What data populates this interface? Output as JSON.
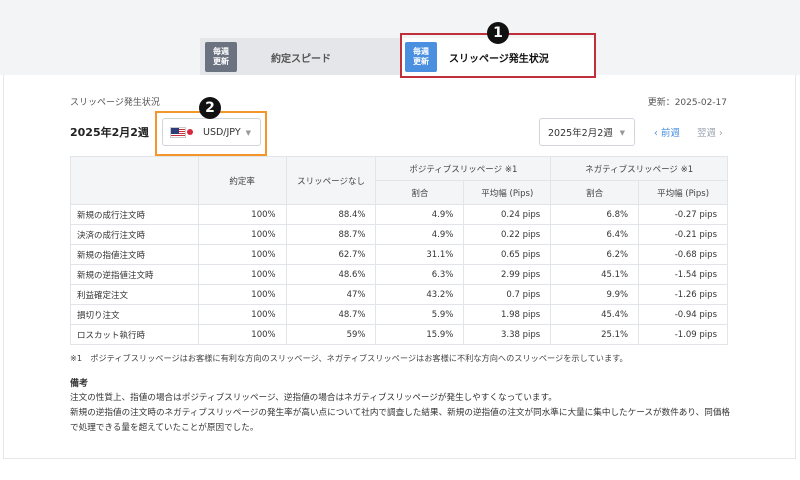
{
  "tabs": [
    {
      "badge_line1": "毎週",
      "badge_line2": "更新",
      "label": "約定スピード"
    },
    {
      "badge_line1": "毎週",
      "badge_line2": "更新",
      "label": "スリッページ発生状況"
    }
  ],
  "callouts": [
    "1",
    "2"
  ],
  "section_title": "スリッページ発生状況",
  "updated": "更新：2025-02-17",
  "week_label": "2025年2月2週",
  "currency": {
    "flag": "us-flag-icon",
    "value": "USD/JPY"
  },
  "date_select": "2025年2月2週",
  "nav": {
    "prev": "‹ 前週",
    "next": "翌週 ›"
  },
  "table": {
    "headers": {
      "fill_rate": "約定率",
      "no_slip": "スリッページなし",
      "positive": "ポジティブスリッページ ※1",
      "negative": "ネガティブスリッページ ※1",
      "ratio": "割合",
      "avg": "平均幅 (Pips)"
    },
    "rows": [
      {
        "label": "新規の成行注文時",
        "fill": "100%",
        "none": "88.4%",
        "pos_ratio": "4.9%",
        "pos_avg": "0.24 pips",
        "neg_ratio": "6.8%",
        "neg_avg": "-0.27 pips"
      },
      {
        "label": "決済の成行注文時",
        "fill": "100%",
        "none": "88.7%",
        "pos_ratio": "4.9%",
        "pos_avg": "0.22 pips",
        "neg_ratio": "6.4%",
        "neg_avg": "-0.21 pips"
      },
      {
        "label": "新規の指値注文時",
        "fill": "100%",
        "none": "62.7%",
        "pos_ratio": "31.1%",
        "pos_avg": "0.65 pips",
        "neg_ratio": "6.2%",
        "neg_avg": "-0.68 pips"
      },
      {
        "label": "新規の逆指値注文時",
        "fill": "100%",
        "none": "48.6%",
        "pos_ratio": "6.3%",
        "pos_avg": "2.99 pips",
        "neg_ratio": "45.1%",
        "neg_avg": "-1.54 pips"
      },
      {
        "label": "利益確定注文",
        "fill": "100%",
        "none": "47%",
        "pos_ratio": "43.2%",
        "pos_avg": "0.7 pips",
        "neg_ratio": "9.9%",
        "neg_avg": "-1.26 pips"
      },
      {
        "label": "損切り注文",
        "fill": "100%",
        "none": "48.7%",
        "pos_ratio": "5.9%",
        "pos_avg": "1.98 pips",
        "neg_ratio": "45.4%",
        "neg_avg": "-0.94 pips"
      },
      {
        "label": "ロスカット執行時",
        "fill": "100%",
        "none": "59%",
        "pos_ratio": "15.9%",
        "pos_avg": "3.38 pips",
        "neg_ratio": "25.1%",
        "neg_avg": "-1.09 pips"
      }
    ]
  },
  "footnote": "※1　ポジティブスリッページはお客様に有利な方向のスリッページ、ネガティブスリッページはお客様に不利な方向へのスリッページを示しています。",
  "notes_title": "備考",
  "notes": [
    "注文の性質上、指値の場合はポジティブスリッページ、逆指値の場合はネガティブスリッページが発生しやすくなっています。",
    "新規の逆指値の注文時のネガティブスリッページの発生率が高い点について社内で調査した結果、新規の逆指値の注文が同水準に大量に集中したケースが数件あり、同価格で処理できる量を超えていたことが原因でした。"
  ]
}
